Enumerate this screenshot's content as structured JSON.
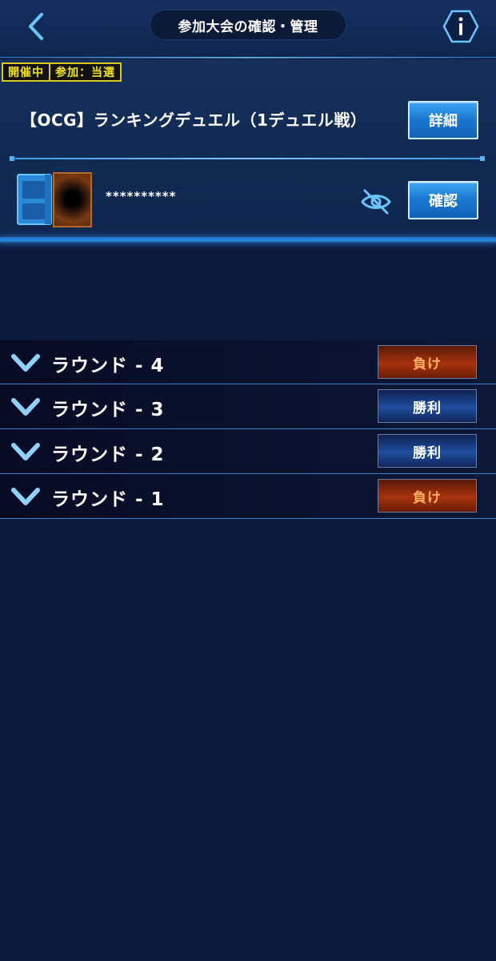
{
  "header": {
    "title": "参加大会の確認・管理",
    "back_icon": "chevron-left-icon",
    "info_icon": "info-icon"
  },
  "status": {
    "tags": [
      "開催中",
      "参加：当選"
    ]
  },
  "tournament": {
    "name": "【OCG】ランキングデュエル（1デュエル戦）",
    "details_label": "詳細",
    "deck_name_masked": "**********",
    "confirm_label": "確認",
    "visibility_icon": "eye-off-icon"
  },
  "rounds": [
    {
      "label": "ラウンド - 4",
      "result": "負け",
      "outcome": "lose"
    },
    {
      "label": "ラウンド - 3",
      "result": "勝利",
      "outcome": "win"
    },
    {
      "label": "ラウンド - 2",
      "result": "勝利",
      "outcome": "win"
    },
    {
      "label": "ラウンド - 1",
      "result": "負け",
      "outcome": "lose"
    }
  ],
  "colors": {
    "background": "#0c1a3e",
    "accent": "#3aa6f2",
    "tag_yellow": "#f2e21a",
    "lose": "#a8320c",
    "win": "#1f4ea0"
  }
}
